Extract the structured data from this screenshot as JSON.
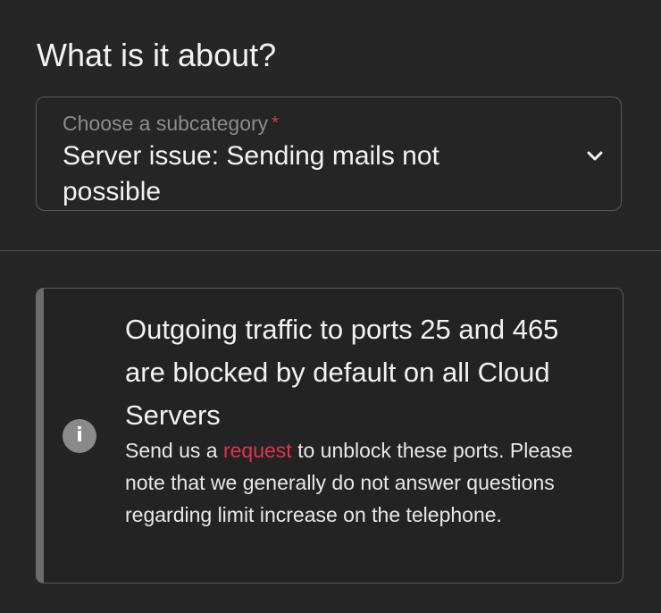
{
  "page": {
    "heading": "What is it about?"
  },
  "subcategory_select": {
    "label": "Choose a subcategory",
    "required_marker": "*",
    "value": "Server issue: Sending mails not possible",
    "icon": "chevron-down-icon"
  },
  "notice": {
    "icon": "info-icon",
    "icon_glyph": "i",
    "title": "Outgoing traffic to ports 25 and 465 are blocked by default on all Cloud Servers",
    "body_before_link": "Send us a ",
    "link_text": "request",
    "body_after_link": " to unblock these ports. Please note that we generally do not answer questions regarding limit increase on the telephone."
  },
  "colors": {
    "background": "#262626",
    "border": "#5a5a5a",
    "accent": "#e0334f",
    "muted_text": "#8c8c8c",
    "info_icon_bg": "#8a8a8a"
  }
}
